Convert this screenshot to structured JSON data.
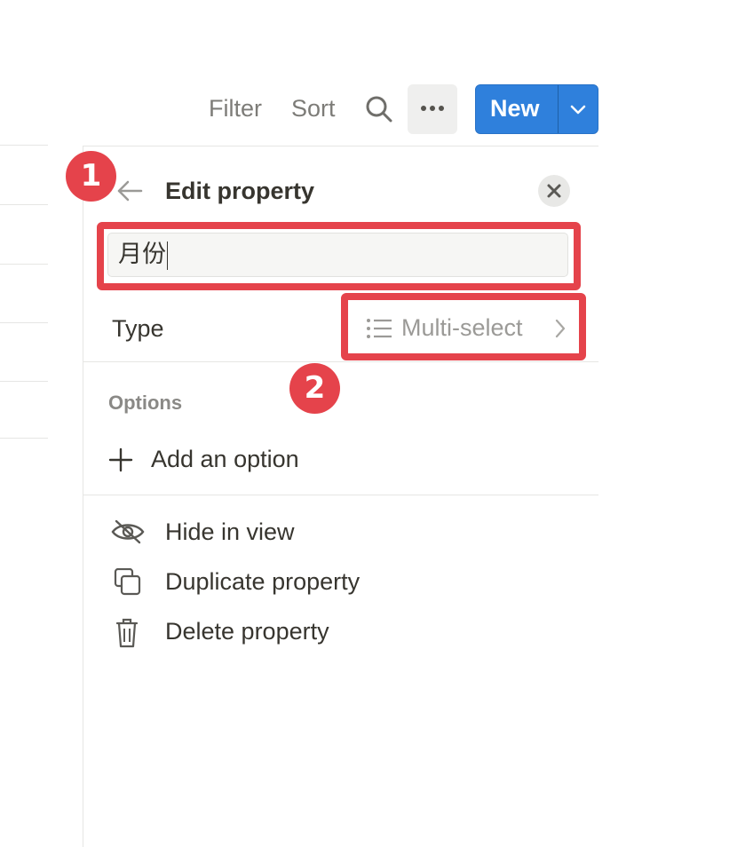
{
  "toolbar": {
    "filter_label": "Filter",
    "sort_label": "Sort",
    "search_icon": "search-icon",
    "more_icon": "more-horizontal-icon",
    "new_label": "New",
    "accent_color": "#2f80dc"
  },
  "panel": {
    "title": "Edit property",
    "back_icon": "arrow-left-icon",
    "close_icon": "close-icon",
    "name_value": "月份",
    "type_label": "Type",
    "type_value": "Multi-select",
    "type_icon": "list-icon",
    "options_heading": "Options",
    "add_option_label": "Add an option",
    "menu": [
      {
        "label": "Hide in view",
        "icon": "eye-off-icon"
      },
      {
        "label": "Duplicate property",
        "icon": "duplicate-icon"
      },
      {
        "label": "Delete property",
        "icon": "trash-icon"
      }
    ]
  },
  "annotations": {
    "badge_1": "1",
    "badge_2": "2",
    "highlight_color": "#e5434b"
  }
}
